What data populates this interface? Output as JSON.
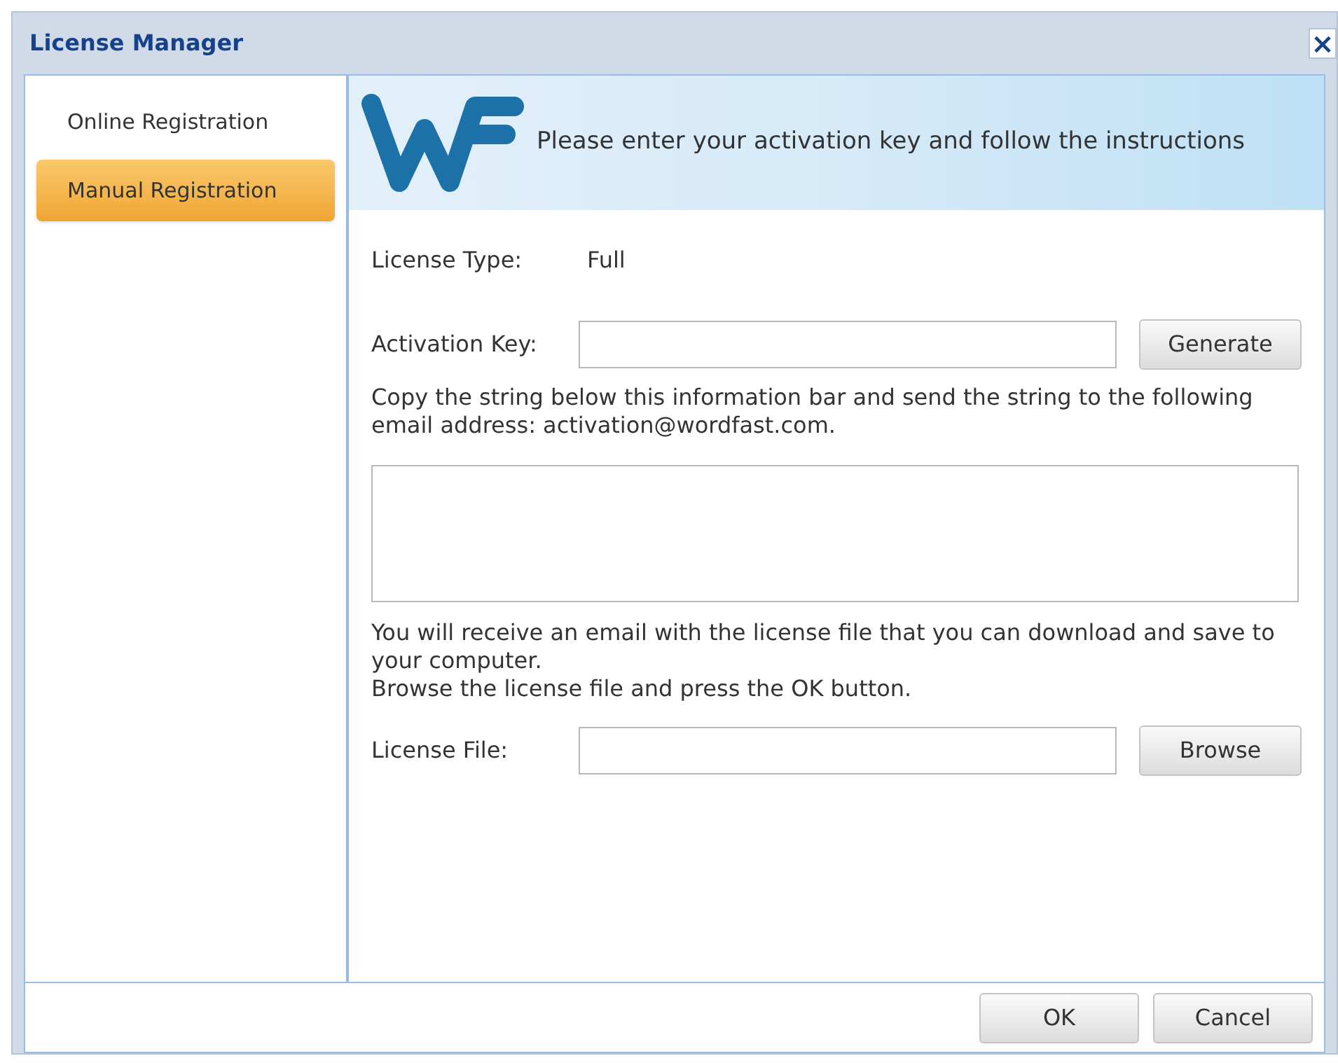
{
  "window": {
    "title": "License Manager",
    "close": "×"
  },
  "sidebar": {
    "items": [
      {
        "label": "Online Registration",
        "selected": false
      },
      {
        "label": "Manual Registration",
        "selected": true
      }
    ]
  },
  "header": {
    "text": "Please enter your activation key and follow the instructions"
  },
  "license_type": {
    "label": "License Type:",
    "value": "Full"
  },
  "activation_key": {
    "label": "Activation Key:",
    "button": "Generate"
  },
  "instructions": "Copy the string below this information bar and send the string to the following email address: activation@wordfast.com.",
  "note_lines": [
    "You will receive an email with the license file that you can download and save to your computer.",
    "Browse the license file and press the OK button."
  ],
  "license_file": {
    "label": "License File:",
    "button": "Browse"
  },
  "buttons": [
    "OK",
    "Cancel"
  ]
}
